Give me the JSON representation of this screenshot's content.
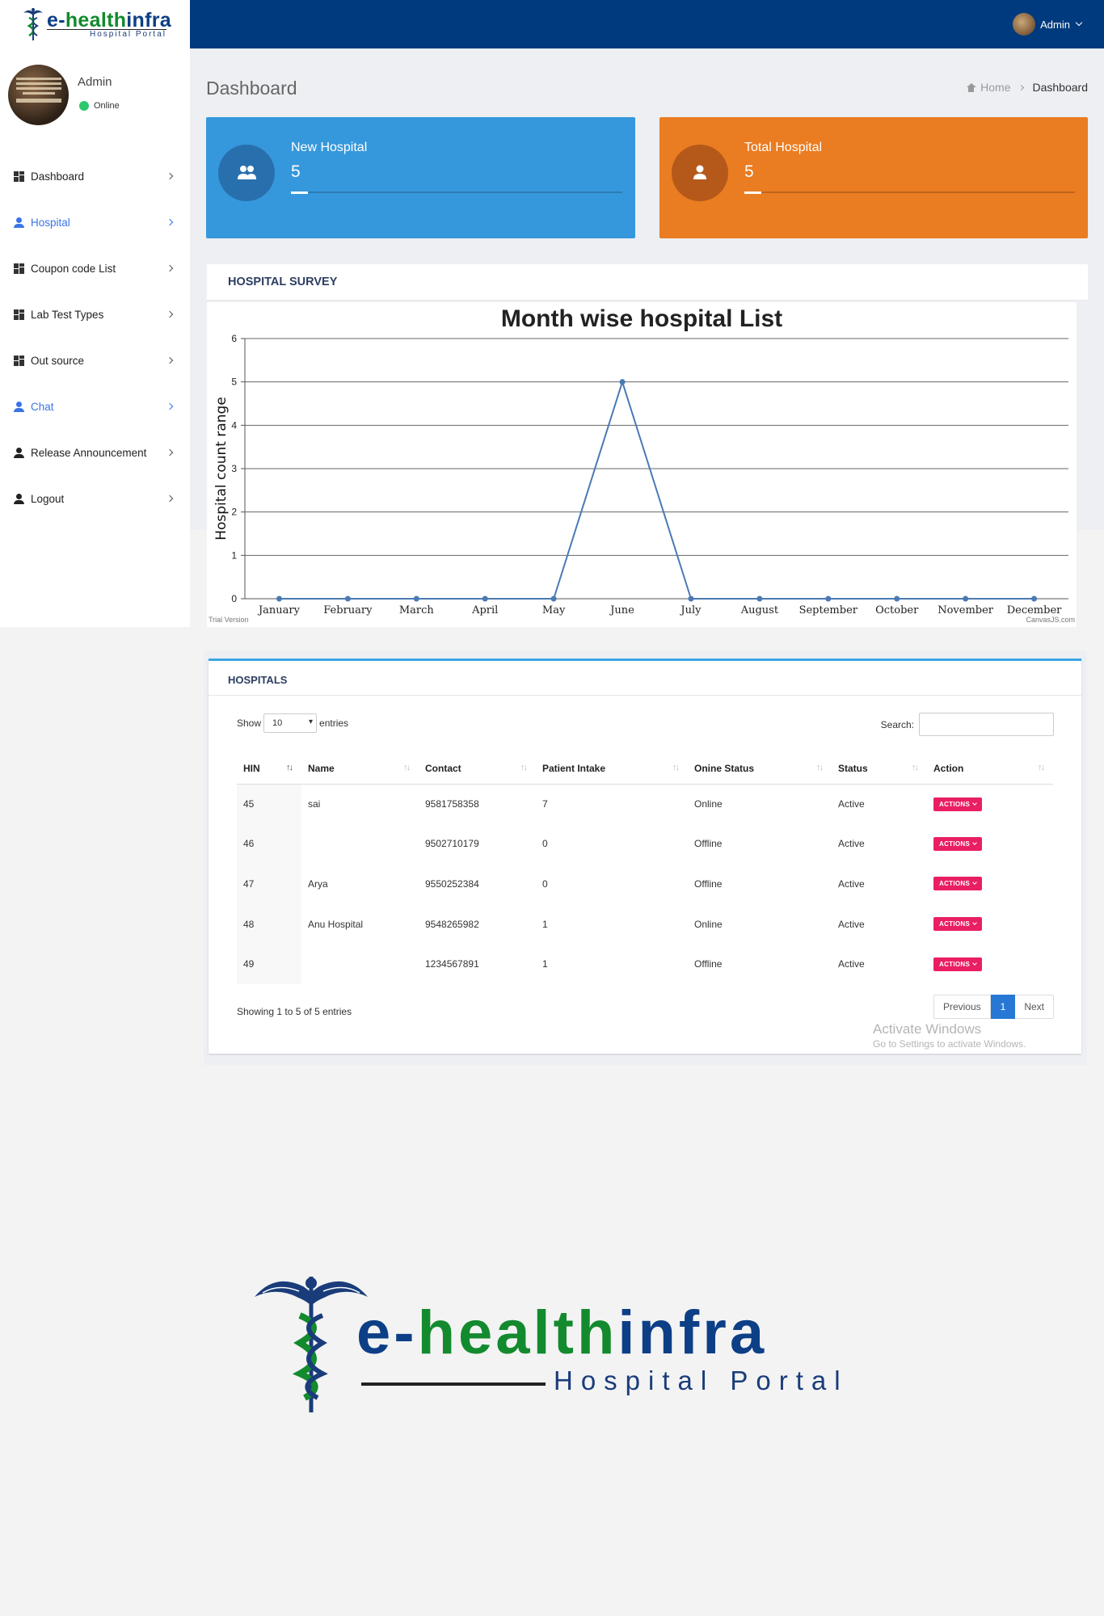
{
  "header": {
    "brand_prefix": "e-",
    "brand_health": "health",
    "brand_infra": "infra",
    "brand_sub": "Hospital Portal",
    "user_name": "Admin"
  },
  "sidebar": {
    "profile_name": "Admin",
    "profile_status": "Online",
    "items": [
      {
        "label": "Dashboard",
        "icon": "grid-icon"
      },
      {
        "label": "Hospital",
        "icon": "person-icon"
      },
      {
        "label": "Coupon code List",
        "icon": "grid-icon"
      },
      {
        "label": "Lab Test Types",
        "icon": "grid-icon"
      },
      {
        "label": "Out source",
        "icon": "grid-icon"
      },
      {
        "label": "Chat",
        "icon": "person-icon"
      },
      {
        "label": "Release Announcement",
        "icon": "person-icon"
      },
      {
        "label": "Logout",
        "icon": "person-icon"
      }
    ]
  },
  "page": {
    "title": "Dashboard",
    "breadcrumb_home": "Home",
    "breadcrumb_current": "Dashboard"
  },
  "stats": {
    "new_hospital": {
      "label": "New Hospital",
      "value": "5",
      "color": "#3698dc"
    },
    "total_hospital": {
      "label": "Total Hospital",
      "value": "5",
      "color": "#ea7c21"
    }
  },
  "survey": {
    "heading": "HOSPITAL SURVEY",
    "trial_text": "Trial Version",
    "credit_text": "CanvasJS.com"
  },
  "chart_data": {
    "type": "line",
    "title": "Month wise hospital List",
    "xlabel": "",
    "ylabel": "Hospital count range",
    "categories": [
      "January",
      "February",
      "March",
      "April",
      "May",
      "June",
      "July",
      "August",
      "September",
      "October",
      "November",
      "December"
    ],
    "values": [
      0,
      0,
      0,
      0,
      0,
      5,
      0,
      0,
      0,
      0,
      0,
      0
    ],
    "ylim": [
      0,
      6
    ],
    "yticks": [
      0,
      1,
      2,
      3,
      4,
      5,
      6
    ],
    "grid": true,
    "line_color": "#4a7ab4"
  },
  "hospitals": {
    "heading": "HOSPITALS",
    "show_label": "Show",
    "entries_label": "entries",
    "page_size": "10",
    "search_label": "Search:",
    "search_value": "",
    "columns": [
      "HIN",
      "Name",
      "Contact",
      "Patient Intake",
      "Onine Status",
      "Status",
      "Action"
    ],
    "rows": [
      {
        "hin": "45",
        "name": "sai",
        "contact": "9581758358",
        "intake": "7",
        "online": "Online",
        "status": "Active",
        "action": "ACTIONS"
      },
      {
        "hin": "46",
        "name": "",
        "contact": "9502710179",
        "intake": "0",
        "online": "Offline",
        "status": "Active",
        "action": "ACTIONS"
      },
      {
        "hin": "47",
        "name": "Arya",
        "contact": "9550252384",
        "intake": "0",
        "online": "Offline",
        "status": "Active",
        "action": "ACTIONS"
      },
      {
        "hin": "48",
        "name": "Anu Hospital",
        "contact": "9548265982",
        "intake": "1",
        "online": "Online",
        "status": "Active",
        "action": "ACTIONS"
      },
      {
        "hin": "49",
        "name": "",
        "contact": "1234567891",
        "intake": "1",
        "online": "Offline",
        "status": "Active",
        "action": "ACTIONS"
      }
    ],
    "showing_text": "Showing 1 to 5 of 5 entries",
    "prev_label": "Previous",
    "current_page": "1",
    "next_label": "Next"
  },
  "watermark": {
    "line1": "Activate Windows",
    "line2": "Go to Settings to activate Windows."
  },
  "big_logo": {
    "prefix": "e-",
    "health": "health",
    "infra": "infra",
    "sub": "Hospital Portal"
  }
}
